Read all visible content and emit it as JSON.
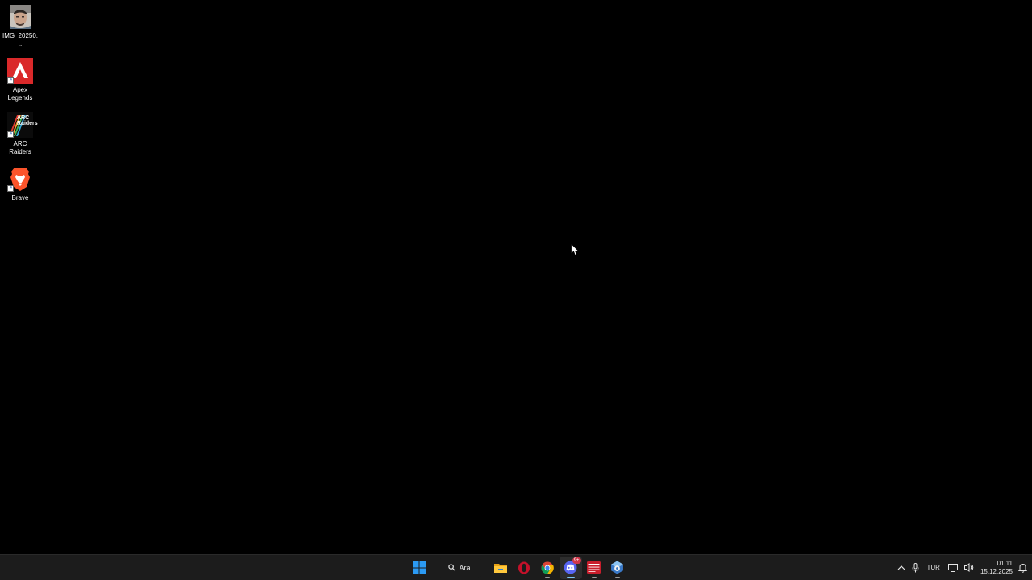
{
  "desktop": {
    "icons": [
      {
        "label": "IMG_20250...",
        "icon": "photo-thumbnail-icon"
      },
      {
        "label": "Apex Legends",
        "icon": "apex-legends-icon"
      },
      {
        "label": "ARC Raiders",
        "icon": "arc-raiders-icon"
      },
      {
        "label": "Brave",
        "icon": "brave-lion-icon"
      }
    ],
    "arc_logo_text": "ARC Raiders"
  },
  "taskbar": {
    "search_label": "Ara",
    "apps": [
      {
        "name": "File Explorer",
        "icon": "folder-icon",
        "running": false
      },
      {
        "name": "Opera",
        "icon": "opera-icon",
        "running": false
      },
      {
        "name": "Google Chrome",
        "icon": "chrome-icon",
        "running": true
      },
      {
        "name": "Discord",
        "icon": "discord-icon",
        "running": true,
        "active": true,
        "badge": "9+"
      },
      {
        "name": "Video Editor",
        "icon": "video-app-icon",
        "running": true
      },
      {
        "name": "Settings Utility",
        "icon": "gear-cube-icon",
        "running": true
      }
    ],
    "tray": {
      "language": "TUR",
      "time": "01:11",
      "date": "15.12.2025"
    }
  },
  "colors": {
    "desktop_bg": "#000000",
    "taskbar_bg": "#1c1c1c",
    "windows_blue": "#2b9af3",
    "apex_red": "#da292a",
    "brave_orange": "#fb542b"
  }
}
